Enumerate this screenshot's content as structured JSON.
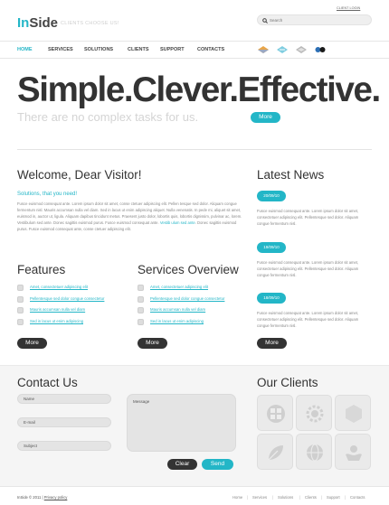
{
  "header": {
    "logo_part1": "In",
    "logo_part2": "Side",
    "tagline": "CLIENTS CHOOSE US!",
    "client_login": "CLIENT LOGIN",
    "search_placeholder": "Search"
  },
  "nav": {
    "items": [
      "HOME",
      "SERVICES",
      "SOLUTIONS",
      "CLIENTS",
      "SUPPORT",
      "CONTACTS"
    ],
    "active": "HOME"
  },
  "hero": {
    "title": "Simple.Clever.Effective.",
    "subtitle": "There are no complex tasks for us.",
    "more_label": "More"
  },
  "welcome": {
    "title": "Welcome, Dear Visitor!",
    "subtitle": "Solutions, that you need!",
    "body_1": "Fusce euismod consequat ante. Lorem ipsum dolor sit amet, conse ctetuer adipiscing elit. Pellen tesque sed dolor. Aliquam congue fermentum nisl. Mauris accumsan nulla vel diam. Sed in lacus ut enim adipiscing aliquet. Nulla venenatis. In pede mi, aliquet sit amet, euismod in, auctor ut, ligula. Aliquam dapibus tincidunt metus. Praesent justo dolor, lobortis quis, lobortis dignissim, pulvinar ac, lorem. Vestibulum sed ante. Donec sagittis euismod purus. Fusce euismod consequat ante.",
    "body_link": "Vestib ulum sed ante",
    "body_2": "Donec sagittis euismod purus.",
    "body_3": "Fusce euismod consequat ante, conse ctetuer adipiscing elit."
  },
  "features": {
    "title": "Features",
    "items": [
      "Amet, consectetuer adipiscing elit",
      "Pellentesque sed dolor congue consectetur",
      "Mauris accumsan nulla vel diam",
      "Sed in lacus ut enim adipiscing"
    ],
    "more_label": "More"
  },
  "services": {
    "title": "Services Overview",
    "items": [
      "Amet, consectetuer adipiscing elit",
      "Pellentesque sed dolor congue consectetur",
      "Mauris accumsan nulla vel diam",
      "Sed in lacus ut enim adipiscing"
    ],
    "more_label": "More"
  },
  "news": {
    "title": "Latest News",
    "items": [
      {
        "date": "20/09/10",
        "text": "Fusce euismod consequat ante. Lorem ipsum dolor sit amet, consectetuer adipiscing elit. Pellentesque sed dolor. Aliquam congue fermentum nisl."
      },
      {
        "date": "19/09/10",
        "text": "Fusce euismod consequat ante. Lorem ipsum dolor sit amet, consectetuer adipiscing elit. Pellentesque sed dolor. Aliquam congue fermentum nisl."
      },
      {
        "date": "18/09/10",
        "text": "Fusce euismod consequat ante. Lorem ipsum dolor sit amet, consectetuer adipiscing elit. Pellentesque sed dolor. Aliquam congue fermentum nisl."
      }
    ],
    "more_label": "More"
  },
  "contact": {
    "title": "Contact Us",
    "name_label": "Name",
    "email_label": "E-mail",
    "subject_label": "Subject",
    "message_label": "Message",
    "clear_label": "Clear",
    "send_label": "Send"
  },
  "clients": {
    "title": "Our Clients",
    "icons": [
      "puzzle-icon",
      "gear-icon",
      "hexagon-icon",
      "leaf-icon",
      "globe-icon",
      "hands-icon"
    ]
  },
  "footer": {
    "copyright": "InSide © 2011",
    "privacy": "Privacy policy",
    "links": [
      "Home",
      "Services",
      "Solutions",
      "Clients",
      "Support",
      "Contacts"
    ]
  },
  "colors": {
    "accent": "#23b6c7",
    "dark": "#333333",
    "text": "#888888"
  }
}
